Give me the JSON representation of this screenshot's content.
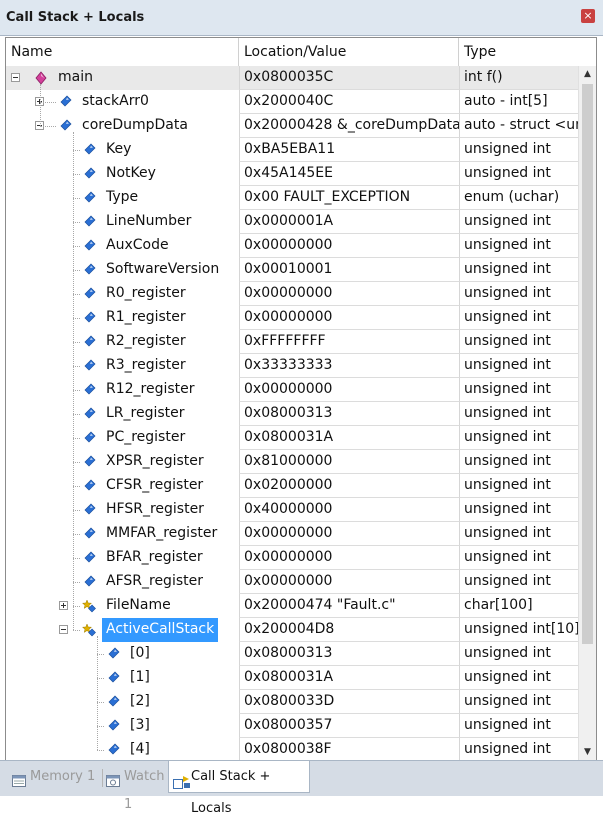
{
  "window": {
    "title": "Call Stack + Locals",
    "close_glyph": "×"
  },
  "columns": {
    "name": "Name",
    "value": "Location/Value",
    "type": "Type"
  },
  "icons": {
    "function": "pink-diamond-icon",
    "variable": "blue-diamond-icon",
    "array": "yellow-star-array-icon",
    "function_color": "#d3409a",
    "variable_color": "#2a6fd4",
    "array_color": "#e0b000",
    "selection_color": "#3399ff"
  },
  "rows": [
    {
      "depth": 0,
      "expander": "minus",
      "icon": "function",
      "name": "main",
      "value": "0x0800035C",
      "type": "int f()"
    },
    {
      "depth": 1,
      "expander": "plus",
      "icon": "variable",
      "name": "stackArr0",
      "value": "0x2000040C",
      "type": "auto - int[5]"
    },
    {
      "depth": 1,
      "expander": "minus",
      "icon": "variable",
      "name": "coreDumpData",
      "value": "0x20000428 &_coreDumpData",
      "type": "auto - struct <unt"
    },
    {
      "depth": 2,
      "expander": "",
      "icon": "variable",
      "name": "Key",
      "value": "0xBA5EBA11",
      "type": "unsigned int"
    },
    {
      "depth": 2,
      "expander": "",
      "icon": "variable",
      "name": "NotKey",
      "value": "0x45A145EE",
      "type": "unsigned int"
    },
    {
      "depth": 2,
      "expander": "",
      "icon": "variable",
      "name": "Type",
      "value": "0x00 FAULT_EXCEPTION",
      "type": "enum (uchar)"
    },
    {
      "depth": 2,
      "expander": "",
      "icon": "variable",
      "name": "LineNumber",
      "value": "0x0000001A",
      "type": "unsigned int"
    },
    {
      "depth": 2,
      "expander": "",
      "icon": "variable",
      "name": "AuxCode",
      "value": "0x00000000",
      "type": "unsigned int"
    },
    {
      "depth": 2,
      "expander": "",
      "icon": "variable",
      "name": "SoftwareVersion",
      "value": "0x00010001",
      "type": "unsigned int"
    },
    {
      "depth": 2,
      "expander": "",
      "icon": "variable",
      "name": "R0_register",
      "value": "0x00000000",
      "type": "unsigned int"
    },
    {
      "depth": 2,
      "expander": "",
      "icon": "variable",
      "name": "R1_register",
      "value": "0x00000000",
      "type": "unsigned int"
    },
    {
      "depth": 2,
      "expander": "",
      "icon": "variable",
      "name": "R2_register",
      "value": "0xFFFFFFFF",
      "type": "unsigned int"
    },
    {
      "depth": 2,
      "expander": "",
      "icon": "variable",
      "name": "R3_register",
      "value": "0x33333333",
      "type": "unsigned int"
    },
    {
      "depth": 2,
      "expander": "",
      "icon": "variable",
      "name": "R12_register",
      "value": "0x00000000",
      "type": "unsigned int"
    },
    {
      "depth": 2,
      "expander": "",
      "icon": "variable",
      "name": "LR_register",
      "value": "0x08000313",
      "type": "unsigned int"
    },
    {
      "depth": 2,
      "expander": "",
      "icon": "variable",
      "name": "PC_register",
      "value": "0x0800031A",
      "type": "unsigned int"
    },
    {
      "depth": 2,
      "expander": "",
      "icon": "variable",
      "name": "XPSR_register",
      "value": "0x81000000",
      "type": "unsigned int"
    },
    {
      "depth": 2,
      "expander": "",
      "icon": "variable",
      "name": "CFSR_register",
      "value": "0x02000000",
      "type": "unsigned int"
    },
    {
      "depth": 2,
      "expander": "",
      "icon": "variable",
      "name": "HFSR_register",
      "value": "0x40000000",
      "type": "unsigned int"
    },
    {
      "depth": 2,
      "expander": "",
      "icon": "variable",
      "name": "MMFAR_register",
      "value": "0x00000000",
      "type": "unsigned int"
    },
    {
      "depth": 2,
      "expander": "",
      "icon": "variable",
      "name": "BFAR_register",
      "value": "0x00000000",
      "type": "unsigned int"
    },
    {
      "depth": 2,
      "expander": "",
      "icon": "variable",
      "name": "AFSR_register",
      "value": "0x00000000",
      "type": "unsigned int"
    },
    {
      "depth": 2,
      "expander": "plus",
      "icon": "array",
      "name": "FileName",
      "value": "0x20000474 \"Fault.c\"",
      "type": "char[100]"
    },
    {
      "depth": 2,
      "expander": "minus",
      "icon": "array",
      "name": "ActiveCallStack",
      "value": "0x200004D8",
      "type": "unsigned int[10]",
      "highlight": true
    },
    {
      "depth": 3,
      "expander": "",
      "icon": "variable",
      "name": "[0]",
      "value": "0x08000313",
      "type": "unsigned int"
    },
    {
      "depth": 3,
      "expander": "",
      "icon": "variable",
      "name": "[1]",
      "value": "0x0800031A",
      "type": "unsigned int"
    },
    {
      "depth": 3,
      "expander": "",
      "icon": "variable",
      "name": "[2]",
      "value": "0x0800033D",
      "type": "unsigned int"
    },
    {
      "depth": 3,
      "expander": "",
      "icon": "variable",
      "name": "[3]",
      "value": "0x08000357",
      "type": "unsigned int"
    },
    {
      "depth": 3,
      "expander": "",
      "icon": "variable",
      "name": "[4]",
      "value": "0x0800038F",
      "type": "unsigned int"
    }
  ],
  "selected_row": 0,
  "scrollbar": {
    "up_glyph": "▲",
    "down_glyph": "▼"
  },
  "tabs": [
    {
      "label": "Memory 1",
      "icon": "memory-window-icon",
      "active": false
    },
    {
      "label": "Watch 1",
      "icon": "watch-window-icon",
      "active": false
    },
    {
      "label": "Call Stack + Locals",
      "icon": "call-stack-icon",
      "active": true
    }
  ]
}
